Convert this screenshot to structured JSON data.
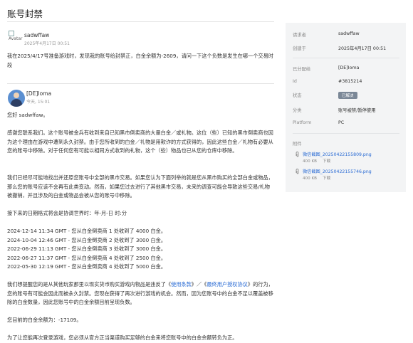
{
  "page": {
    "title": "账号封禁"
  },
  "thread": {
    "first": {
      "author": "sadwffaw",
      "avatar_alt": "Avatar",
      "date": "2025年4月17日 00:51",
      "text": "我在2025/4/17号准备游戏时，发现我的账号给封禁正，白金余额为-2609，请问一下这个负数是发生在哪一个交易时段"
    },
    "reply": {
      "author": "[DE]Ioma",
      "date": "今天, 15:01",
      "greeting": "您好 sadwffaw。",
      "para1": "感谢您联系我们。这个账号被金兵有收到来自已知黑市倒卖商的大量白金／或礼物。这位（些）已知的黑市倒卖商也因为这个理由在游戏中遭到永久封禁。由于您所收到的白金／礼物是用欺诈的方式获得的，因此这些白金／礼物有必要从您的账号中移除。对于任何您有可能以相同方式收到的礼物，这个（些）物品也已从您的仓库中移除。",
      "para2": "我们已经尽可能地找出并还原您账号中全部的黑市交易。如果您认为下面列举的就是您从黑市购买的全部白金或物品，那么您的账号应该不会再有此类变动。然而，如果您过去进行了其他黑市交易，未来的调查可能会导致这些交易/礼物被撤销，并且涉及的白金或物品会被从您的账号中移除。",
      "para3": "接下来的日期格式将会是协调世界时：年-月-日 时:分",
      "transactions": [
        "2024-12-14 11:34 GMT - 您从白金倒卖商 1 处收到了 4000 白金。",
        "2024-10-04 12:46 GMT - 您从白金倒卖商 2 处收到了 3000 白金。",
        "2022-06-29 11:13 GMT - 您从白金倒卖商 3 处收到了 3000 白金。",
        "2022-06-27 11:37 GMT - 您从白金倒卖商 4 处收到了 2500 白金。",
        "2022-05-30 12:19 GMT - 您从白金倒卖商 4 处收到了 5000 白金。"
      ],
      "para4_before": "我们想提醒您的是从其他玩家那里以现实货币购买游戏内物品是违反了《",
      "terms_link": "使用条款",
      "para4_mid": "》／《",
      "eula_link": "最终用户授权协议",
      "para4_after": "》的行为，您的账号有可能会因此而被永久封禁。您现在获得了再次进行游戏的机会。然而，因为您账号中的白金不足以覆盖被移除的白金数量，因此您账号中的白金余额目前呈现负数。",
      "balance": "您目前的白金余额为：-17109。",
      "para5": "为了让您能再次登录游戏，您必须从官方正当渠道购买足够的白金来将您账号中的白金余额转负为正。"
    }
  },
  "sidebar": {
    "requester_label": "请求者",
    "requester": "sadwffaw",
    "created_label": "创建于",
    "created": "2025年4月17日 00:51",
    "assigned_label": "已分配给",
    "assigned": "[DE]Ioma",
    "id_label": "Id",
    "id": "#3815214",
    "status_label": "状态",
    "status": "已解决",
    "category_label": "分类",
    "category": "账号被禁/暂停使用",
    "platform_label": "Platform",
    "platform": "PC",
    "attachments_label": "附件",
    "attachments": [
      {
        "name": "微信截图_20250422155809.png",
        "size": "400 KB",
        "download": "下载"
      },
      {
        "name": "微信截图_20250422155746.png",
        "size": "400 KB",
        "download": "下载"
      }
    ]
  },
  "colors": {
    "link": "#2a6bd4",
    "badge": "#7a8796",
    "sidebar_bg": "#f3f4f5"
  }
}
